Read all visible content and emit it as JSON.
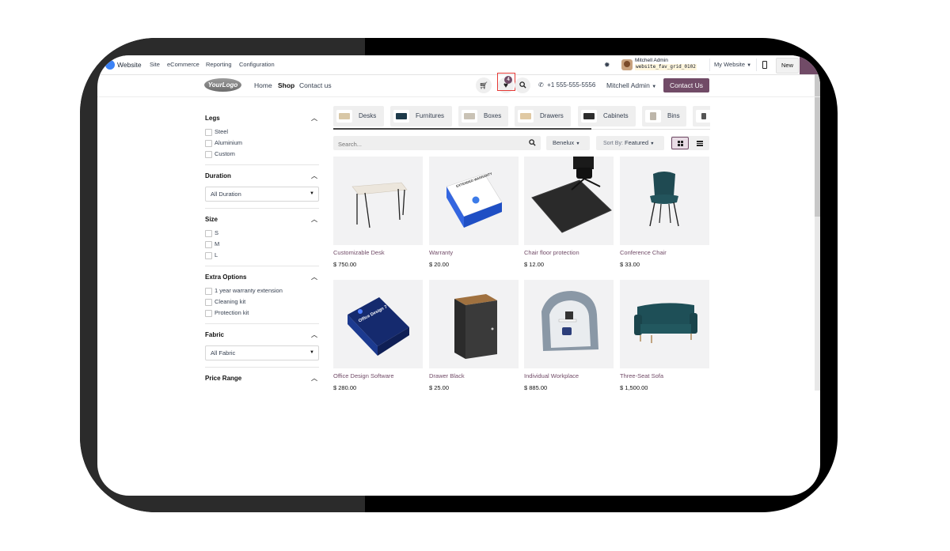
{
  "admin_bar": {
    "app_name": "Website",
    "menus": [
      "Site",
      "eCommerce",
      "Reporting",
      "Configuration"
    ],
    "user_name": "Mitchell Admin",
    "database": "website_fav_grid_0102",
    "website_switcher": "My Website",
    "new_label": "New"
  },
  "header": {
    "logo_text": "YourLogo",
    "nav": [
      "Home",
      "Shop",
      "Contact us"
    ],
    "active_nav": "Shop",
    "wishlist_count": "4",
    "phone": "+1 555-555-5556",
    "user_menu": "Mitchell Admin",
    "contact_button": "Contact Us"
  },
  "filters": {
    "legs": {
      "title": "Legs",
      "options": [
        "Steel",
        "Aluminium",
        "Custom"
      ]
    },
    "duration": {
      "title": "Duration",
      "selected": "All Duration"
    },
    "size": {
      "title": "Size",
      "options": [
        "S",
        "M",
        "L"
      ]
    },
    "extra": {
      "title": "Extra Options",
      "options": [
        "1 year warranty extension",
        "Cleaning kit",
        "Protection kit"
      ]
    },
    "fabric": {
      "title": "Fabric",
      "selected": "All Fabric"
    },
    "price": {
      "title": "Price Range"
    }
  },
  "categories": [
    "Desks",
    "Furnitures",
    "Boxes",
    "Drawers",
    "Cabinets",
    "Bins"
  ],
  "toolbar": {
    "search_placeholder": "Search...",
    "pricelist": "Benelux",
    "sort_prefix": "Sort By:",
    "sort_value": "Featured"
  },
  "products": [
    {
      "name": "Customizable Desk",
      "price": "$ 750.00"
    },
    {
      "name": "Warranty",
      "price": "$ 20.00"
    },
    {
      "name": "Chair floor protection",
      "price": "$ 12.00"
    },
    {
      "name": "Conference Chair",
      "price": "$ 33.00"
    },
    {
      "name": "Office Design Software",
      "price": "$ 280.00"
    },
    {
      "name": "Drawer Black",
      "price": "$ 25.00"
    },
    {
      "name": "Individual Workplace",
      "price": "$ 885.00"
    },
    {
      "name": "Three-Seat Sofa",
      "price": "$ 1,500.00"
    }
  ],
  "product_art": {
    "warranty_box": "EXTENDED WARRANTY",
    "software_box": "Office Design 7"
  },
  "colors": {
    "accent": "#714b67",
    "highlight": "#e53935"
  }
}
